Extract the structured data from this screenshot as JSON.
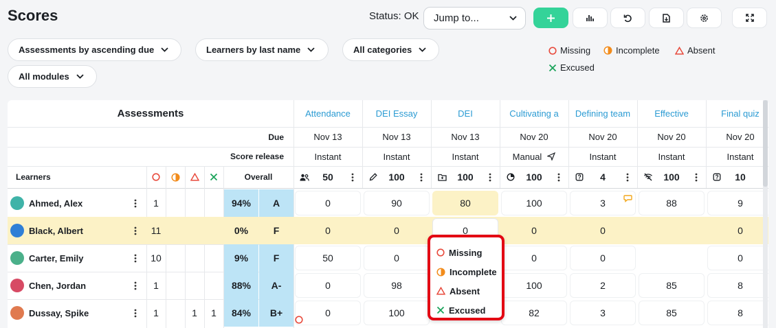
{
  "header": {
    "title": "Scores",
    "status": "Status: OK",
    "jump_label": "Jump to...",
    "toolbar": [
      "add-icon",
      "chart-icon",
      "undo-icon",
      "export-icon",
      "settings-icon",
      "expand-icon"
    ]
  },
  "filters": {
    "sort_assessments": "Assessments by ascending due",
    "sort_learners": "Learners by last name",
    "categories": "All categories",
    "modules": "All modules"
  },
  "legend": {
    "missing": "Missing",
    "incomplete": "Incomplete",
    "absent": "Absent",
    "excused": "Excused"
  },
  "grid": {
    "assessments_header": "Assessments",
    "due_label": "Due",
    "release_label": "Score release",
    "learners_label": "Learners",
    "overall_label": "Overall",
    "assessments": [
      {
        "name": "Attendance",
        "due": "Nov 13",
        "release": "Instant",
        "icon": "people-icon",
        "points": "50"
      },
      {
        "name": "DEI Essay",
        "due": "Nov 13",
        "release": "Instant",
        "icon": "pencil-icon",
        "points": "100"
      },
      {
        "name": "DEI",
        "due": "Nov 13",
        "release": "Instant",
        "icon": "folder-icon",
        "points": "100"
      },
      {
        "name": "Cultivating a",
        "due": "Nov 20",
        "release": "Manual",
        "icon": "pie-icon",
        "points": "100"
      },
      {
        "name": "Defining team",
        "due": "Nov 20",
        "release": "Instant",
        "icon": "quiz-icon",
        "points": "4"
      },
      {
        "name": "Effective",
        "due": "Nov 20",
        "release": "Instant",
        "icon": "no-wifi-icon",
        "points": "100"
      },
      {
        "name": "Final quiz",
        "due": "Nov 20",
        "release": "Instant",
        "icon": "quiz-icon",
        "points": "10"
      }
    ],
    "learners": [
      {
        "name": "Ahmed, Alex",
        "missing": "1",
        "incomplete": "",
        "absent": "",
        "excused": "",
        "pct": "94%",
        "grade": "A",
        "scores": [
          "0",
          "90",
          "80",
          "100",
          "3",
          "88",
          "9"
        ]
      },
      {
        "name": "Black, Albert",
        "missing": "11",
        "incomplete": "",
        "absent": "",
        "excused": "",
        "pct": "0%",
        "grade": "F",
        "scores": [
          "0",
          "0",
          "0",
          "0",
          "0",
          "",
          "0"
        ]
      },
      {
        "name": "Carter, Emily",
        "missing": "10",
        "incomplete": "",
        "absent": "",
        "excused": "",
        "pct": "9%",
        "grade": "F",
        "scores": [
          "50",
          "0",
          "",
          "0",
          "0",
          "",
          "0"
        ]
      },
      {
        "name": "Chen, Jordan",
        "missing": "1",
        "incomplete": "",
        "absent": "",
        "excused": "",
        "pct": "88%",
        "grade": "A-",
        "scores": [
          "0",
          "98",
          "",
          "100",
          "2",
          "85",
          "8"
        ]
      },
      {
        "name": "Dussay, Spike",
        "missing": "1",
        "incomplete": "",
        "absent": "1",
        "excused": "1",
        "pct": "84%",
        "grade": "B+",
        "scores": [
          "0",
          "100",
          "",
          "82",
          "3",
          "85",
          "8"
        ]
      }
    ]
  },
  "popup": {
    "options": [
      "Missing",
      "Incomplete",
      "Absent",
      "Excused"
    ]
  },
  "colors": {
    "accent": "#34d399",
    "link": "#2b9bd3",
    "highlight": "#fcf2c6",
    "overall": "#bde4f6",
    "missing": "#e84a3c",
    "incomplete": "#f28c1c",
    "excused": "#1aa35a",
    "popup_border": "#e30613"
  }
}
